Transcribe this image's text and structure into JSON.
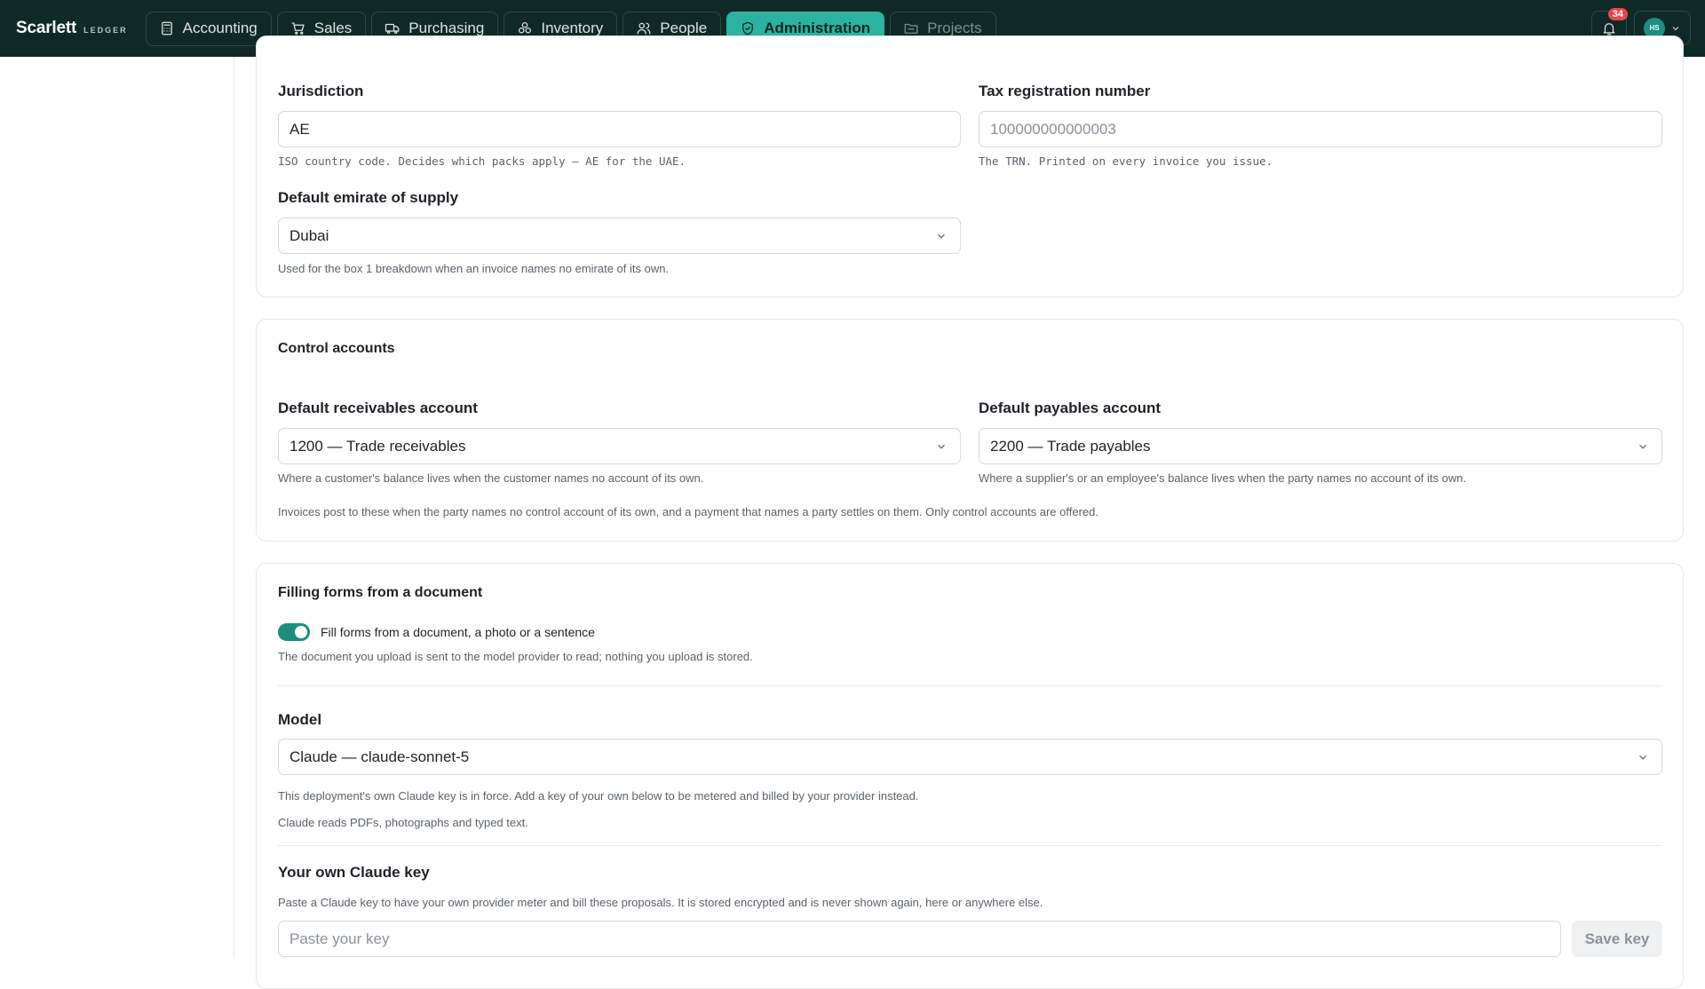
{
  "brand": {
    "name": "Scarlett",
    "sub": "LEDGER"
  },
  "nav": [
    {
      "label": "Accounting",
      "icon": "calculator-icon",
      "state": "normal"
    },
    {
      "label": "Sales",
      "icon": "cart-icon",
      "state": "normal"
    },
    {
      "label": "Purchasing",
      "icon": "truck-icon",
      "state": "normal"
    },
    {
      "label": "Inventory",
      "icon": "boxes-icon",
      "state": "normal"
    },
    {
      "label": "People",
      "icon": "users-icon",
      "state": "normal"
    },
    {
      "label": "Administration",
      "icon": "shield-icon",
      "state": "active"
    },
    {
      "label": "Projects",
      "icon": "folder-icon",
      "state": "disabled"
    }
  ],
  "notifications": {
    "count": "34"
  },
  "user": {
    "initials": "HS"
  },
  "tax": {
    "jurisdiction_label": "Jurisdiction",
    "jurisdiction_value": "AE",
    "jurisdiction_help": "ISO country code. Decides which packs apply — AE for the UAE.",
    "trn_label": "Tax registration number",
    "trn_placeholder": "100000000000003",
    "trn_help": "The TRN. Printed on every invoice you issue.",
    "emirate_label": "Default emirate of supply",
    "emirate_value": "Dubai",
    "emirate_help": "Used for the box 1 breakdown when an invoice names no emirate of its own."
  },
  "control": {
    "title": "Control accounts",
    "receivables_label": "Default receivables account",
    "receivables_value": "1200 — Trade receivables",
    "receivables_help": "Where a customer's balance lives when the customer names no account of its own.",
    "payables_label": "Default payables account",
    "payables_value": "2200 — Trade payables",
    "payables_help": "Where a supplier's or an employee's balance lives when the party names no account of its own.",
    "note": "Invoices post to these when the party names no control account of its own, and a payment that names a party settles on them. Only control accounts are offered."
  },
  "filling": {
    "title": "Filling forms from a document",
    "toggle_label": "Fill forms from a document, a photo or a sentence",
    "toggle_on": true,
    "toggle_help": "The document you upload is sent to the model provider to read; nothing you upload is stored.",
    "model_label": "Model",
    "model_value": "Claude — claude-sonnet-5",
    "model_help1": "This deployment's own Claude key is in force. Add a key of your own below to be metered and billed by your provider instead.",
    "model_help2": "Claude reads PDFs, photographs and typed text.",
    "key_label": "Your own Claude key",
    "key_help": "Paste a Claude key to have your own provider meter and bill these proposals. It is stored encrypted and is never shown again, here or anywhere else.",
    "key_placeholder": "Paste your key",
    "save_label": "Save key"
  }
}
